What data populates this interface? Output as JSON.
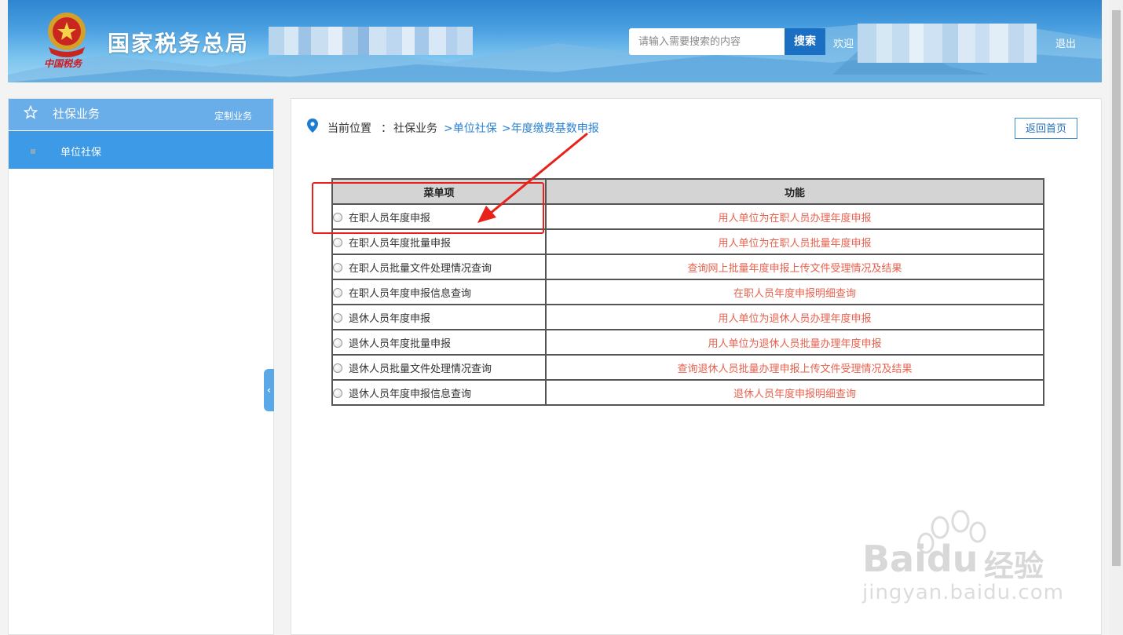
{
  "header": {
    "site_title": "国家税务总局",
    "search_placeholder": "请输入需要搜索的内容",
    "search_button": "搜索",
    "welcome": "欢迎",
    "logout": "退出",
    "emblem_text": "中国税务"
  },
  "sidebar": {
    "title": "社保业务",
    "custom_link": "定制业务",
    "items": [
      {
        "label": "单位社保"
      }
    ]
  },
  "breadcrumb": {
    "prefix": "当前位置",
    "sep": "：",
    "root": "社保业务",
    "level1": ">单位社保",
    "level2": ">年度缴费基数申报"
  },
  "home_button": "返回首页",
  "table": {
    "headers": [
      "菜单项",
      "功能"
    ],
    "rows": [
      {
        "menu": "在职人员年度申报",
        "func": "用人单位为在职人员办理年度申报"
      },
      {
        "menu": "在职人员年度批量申报",
        "func": "用人单位为在职人员批量年度申报"
      },
      {
        "menu": "在职人员批量文件处理情况查询",
        "func": "查询网上批量年度申报上传文件受理情况及结果"
      },
      {
        "menu": "在职人员年度申报信息查询",
        "func": "在职人员年度申报明细查询"
      },
      {
        "menu": "退休人员年度申报",
        "func": "用人单位为退休人员办理年度申报"
      },
      {
        "menu": "退休人员年度批量申报",
        "func": "用人单位为退休人员批量办理年度申报"
      },
      {
        "menu": "退休人员批量文件处理情况查询",
        "func": "查询退休人员批量办理申报上传文件受理情况及结果"
      },
      {
        "menu": "退休人员年度申报信息查询",
        "func": "退休人员年度申报明细查询"
      }
    ]
  },
  "watermark": {
    "brand": "Bai",
    "brand2": "du",
    "product": "经验",
    "url": "jingyan.baidu.com"
  },
  "colors": {
    "header_blue": "#3d8fd8",
    "sidebar_active": "#3d9ae6",
    "func_red": "#e8614d",
    "annotation_red": "#e8211b"
  }
}
